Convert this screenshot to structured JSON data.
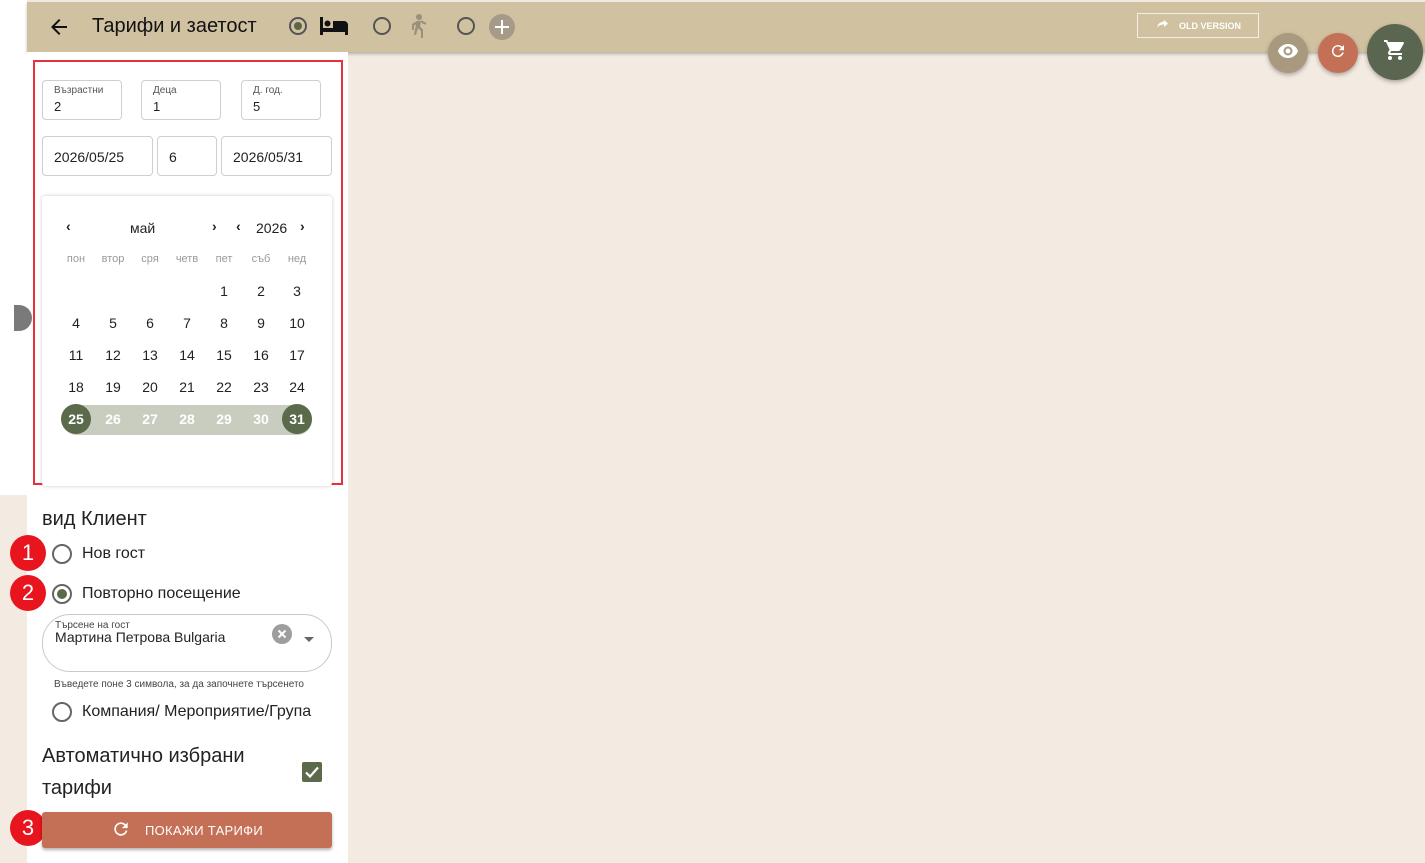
{
  "header": {
    "title": "Тарифи и заетост",
    "old_version_label": "OLD VERSION",
    "modes": [
      {
        "icon": "bed-icon",
        "selected": true
      },
      {
        "icon": "walk-icon",
        "selected": false
      },
      {
        "icon": "add-circle-icon",
        "selected": false
      }
    ]
  },
  "fabs": [
    {
      "icon": "eye-icon",
      "color": "#a99a7f"
    },
    {
      "icon": "refresh-icon",
      "color": "#c47057"
    },
    {
      "icon": "cart-icon",
      "color": "#5b6650"
    }
  ],
  "guests": {
    "adults_label": "Възрастни",
    "adults": "2",
    "children_label": "Деца",
    "children": "1",
    "child_age_label": "Д. год.",
    "child_age": "5"
  },
  "dates": {
    "from": "2026/05/25",
    "nights": "6",
    "to": "2026/05/31"
  },
  "calendar": {
    "month": "май",
    "year": "2026",
    "weekdays": [
      "пон",
      "втор",
      "сря",
      "четв",
      "пет",
      "съб",
      "нед"
    ],
    "weeks": [
      [
        "",
        "",
        "",
        "",
        "1",
        "2",
        "3"
      ],
      [
        "4",
        "5",
        "6",
        "7",
        "8",
        "9",
        "10"
      ],
      [
        "11",
        "12",
        "13",
        "14",
        "15",
        "16",
        "17"
      ],
      [
        "18",
        "19",
        "20",
        "21",
        "22",
        "23",
        "24"
      ],
      [
        "25",
        "26",
        "27",
        "28",
        "29",
        "30",
        "31"
      ]
    ],
    "range_start": "25",
    "range_end": "31"
  },
  "client": {
    "section_title": "вид Клиент",
    "options": [
      "Нов гост",
      "Повторно посещение",
      "Компания/ Мероприятие/Група"
    ],
    "selected_index": 1,
    "search_label": "Търсене на гост",
    "search_value": "Мартина Петрова Bulgaria",
    "hint": "Въведете поне 3 символа, за да започнете търсенето"
  },
  "auto_rates": {
    "label": "Автоматично избрани тарифи",
    "checked": true
  },
  "show_button_label": "ПОКАЖИ ТАРИФИ",
  "badges": [
    "1",
    "2",
    "3"
  ],
  "colors": {
    "header_bg": "#d0c1a0",
    "page_bg": "#f3ebe2",
    "accent_green": "#5b6a4b",
    "accent_terracotta": "#c47057",
    "badge_red": "#e8141e"
  }
}
